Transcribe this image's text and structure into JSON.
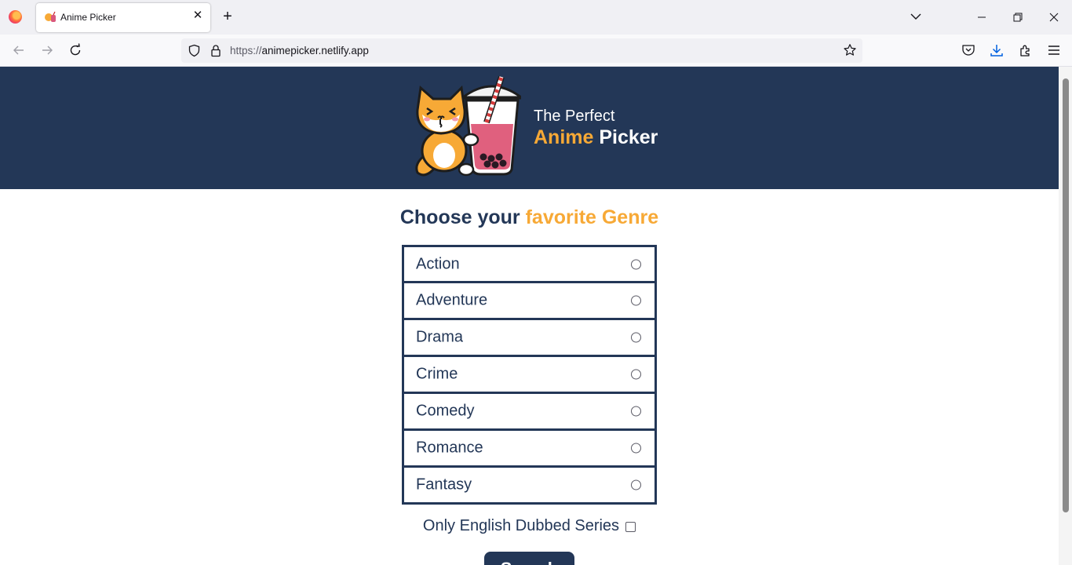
{
  "browser": {
    "tab_title": "Anime Picker",
    "url_scheme": "https://",
    "url_host": "animepicker.netlify.app"
  },
  "hero": {
    "line1": "The Perfect",
    "line2_accent": "Anime",
    "line2_rest": " Picker"
  },
  "heading": {
    "part1": "Choose your ",
    "accent": "favorite Genre"
  },
  "genres": [
    {
      "label": "Action",
      "selected": false
    },
    {
      "label": "Adventure",
      "selected": false
    },
    {
      "label": "Drama",
      "selected": false
    },
    {
      "label": "Crime",
      "selected": false
    },
    {
      "label": "Comedy",
      "selected": false
    },
    {
      "label": "Romance",
      "selected": false
    },
    {
      "label": "Fantasy",
      "selected": false
    }
  ],
  "dub_filter": {
    "label": "Only English Dubbed Series",
    "checked": false
  },
  "search_button": {
    "label": "Search"
  },
  "colors": {
    "navy": "#233757",
    "accent": "#f7a936"
  }
}
